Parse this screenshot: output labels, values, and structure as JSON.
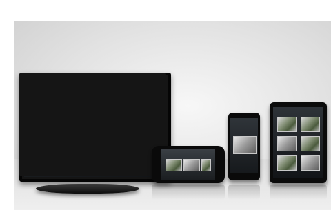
{
  "scene": {
    "description_free": true
  },
  "devices": {
    "monitor": {
      "icon": "monitor-icon"
    },
    "phone_landscape": {
      "icon": "smartphone-icon"
    },
    "phone_portrait": {
      "icon": "smartphone-icon"
    },
    "tablet": {
      "icon": "tablet-icon"
    }
  },
  "colors": {
    "background": "#e2e2e2",
    "device_body": "#0b0b0b",
    "screen": "#1a1d20",
    "brand_accent": "#c01010"
  }
}
